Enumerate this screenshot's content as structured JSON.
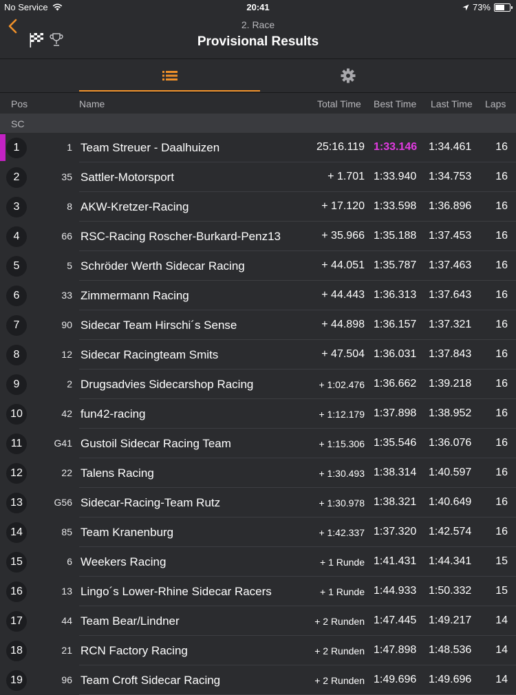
{
  "status": {
    "carrier": "No Service",
    "time": "20:41",
    "battery": "73%",
    "battery_level": 0.73
  },
  "nav": {
    "subtitle": "2. Race",
    "title": "Provisional Results"
  },
  "columns": {
    "pos": "Pos",
    "name": "Name",
    "total": "Total Time",
    "best": "Best Time",
    "last": "Last Time",
    "laps": "Laps"
  },
  "section": "SC",
  "colors": {
    "accent": "#f0912a",
    "best_lap": "#e23be2",
    "background": "#2b2c2f"
  },
  "rows": [
    {
      "pos": "1",
      "num": "1",
      "name": "Team Streuer - Daalhuizen",
      "total": "25:16.119",
      "best": "1:33.146",
      "last": "1:34.461",
      "laps": "16",
      "leader": true,
      "fastest": true
    },
    {
      "pos": "2",
      "num": "35",
      "name": "Sattler-Motorsport",
      "total": "+ 1.701",
      "best": "1:33.940",
      "last": "1:34.753",
      "laps": "16"
    },
    {
      "pos": "3",
      "num": "8",
      "name": "AKW-Kretzer-Racing",
      "total": "+ 17.120",
      "best": "1:33.598",
      "last": "1:36.896",
      "laps": "16"
    },
    {
      "pos": "4",
      "num": "66",
      "name": "RSC-Racing Roscher-Burkard-Penz13",
      "total": "+ 35.966",
      "best": "1:35.188",
      "last": "1:37.453",
      "laps": "16"
    },
    {
      "pos": "5",
      "num": "5",
      "name": "Schröder Werth Sidecar Racing",
      "total": "+ 44.051",
      "best": "1:35.787",
      "last": "1:37.463",
      "laps": "16"
    },
    {
      "pos": "6",
      "num": "33",
      "name": "Zimmermann Racing",
      "total": "+ 44.443",
      "best": "1:36.313",
      "last": "1:37.643",
      "laps": "16"
    },
    {
      "pos": "7",
      "num": "90",
      "name": "Sidecar Team Hirschi´s Sense",
      "total": "+ 44.898",
      "best": "1:36.157",
      "last": "1:37.321",
      "laps": "16"
    },
    {
      "pos": "8",
      "num": "12",
      "name": "Sidecar Racingteam Smits",
      "total": "+ 47.504",
      "best": "1:36.031",
      "last": "1:37.843",
      "laps": "16"
    },
    {
      "pos": "9",
      "num": "2",
      "name": "Drugsadvies Sidecarshop Racing",
      "total": "+ 1:02.476",
      "best": "1:36.662",
      "last": "1:39.218",
      "laps": "16",
      "small": true
    },
    {
      "pos": "10",
      "num": "42",
      "name": "fun42-racing",
      "total": "+ 1:12.179",
      "best": "1:37.898",
      "last": "1:38.952",
      "laps": "16",
      "small": true
    },
    {
      "pos": "11",
      "num": "G41",
      "name": "Gustoil Sidecar Racing Team",
      "total": "+ 1:15.306",
      "best": "1:35.546",
      "last": "1:36.076",
      "laps": "16",
      "small": true
    },
    {
      "pos": "12",
      "num": "22",
      "name": "Talens Racing",
      "total": "+ 1:30.493",
      "best": "1:38.314",
      "last": "1:40.597",
      "laps": "16",
      "small": true
    },
    {
      "pos": "13",
      "num": "G56",
      "name": "Sidecar-Racing-Team Rutz",
      "total": "+ 1:30.978",
      "best": "1:38.321",
      "last": "1:40.649",
      "laps": "16",
      "small": true
    },
    {
      "pos": "14",
      "num": "85",
      "name": "Team Kranenburg",
      "total": "+ 1:42.337",
      "best": "1:37.320",
      "last": "1:42.574",
      "laps": "16",
      "small": true
    },
    {
      "pos": "15",
      "num": "6",
      "name": "Weekers Racing",
      "total": "+ 1 Runde",
      "best": "1:41.431",
      "last": "1:44.341",
      "laps": "15",
      "small": true
    },
    {
      "pos": "16",
      "num": "13",
      "name": "Lingo´s Lower-Rhine Sidecar Racers",
      "total": "+ 1 Runde",
      "best": "1:44.933",
      "last": "1:50.332",
      "laps": "15",
      "small": true
    },
    {
      "pos": "17",
      "num": "44",
      "name": "Team Bear/Lindner",
      "total": "+ 2 Runden",
      "best": "1:47.445",
      "last": "1:49.217",
      "laps": "14",
      "small": true
    },
    {
      "pos": "18",
      "num": "21",
      "name": "RCN Factory Racing",
      "total": "+ 2 Runden",
      "best": "1:47.898",
      "last": "1:48.536",
      "laps": "14",
      "small": true
    },
    {
      "pos": "19",
      "num": "96",
      "name": "Team Croft Sidecar Racing",
      "total": "+ 2 Runden",
      "best": "1:49.696",
      "last": "1:49.696",
      "laps": "14",
      "small": true
    }
  ]
}
